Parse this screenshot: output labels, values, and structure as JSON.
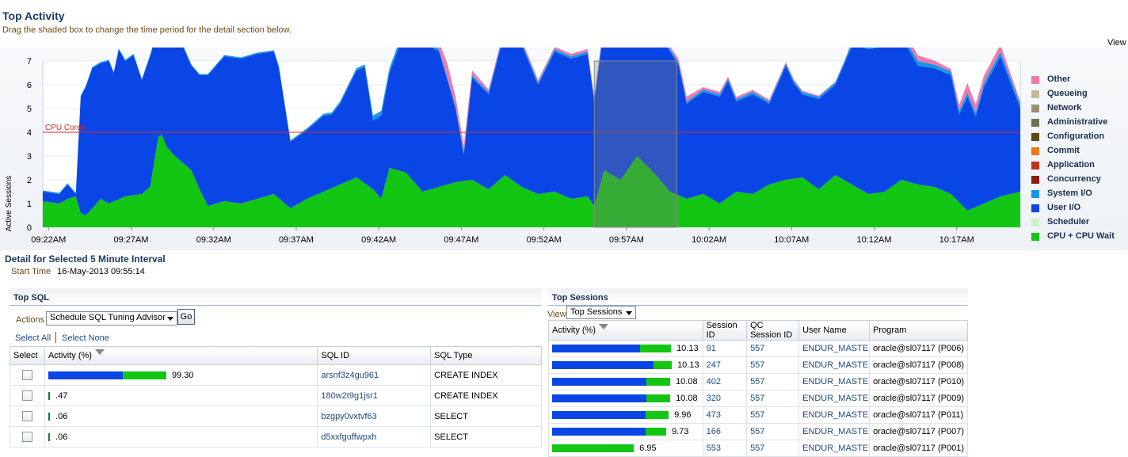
{
  "header": {
    "title": "Top Activity",
    "subtitle": "Drag the shaded box to change the time period for the detail section below.",
    "view_link": "View"
  },
  "colors": {
    "cpu": "#13c613",
    "user_io": "#0a46e6",
    "system_io": "#1896e8",
    "concurrency": "#8b1a10",
    "application": "#c9301b",
    "commit": "#e8781c",
    "configuration": "#5c4a11",
    "administrative": "#6f7352",
    "network": "#9c8e74",
    "queueing": "#c7b996",
    "other": "#f07aa8",
    "scheduler": "#c9f2c2",
    "cpu_cores_line": "#d12b2b"
  },
  "chart_data": {
    "type": "area",
    "ylabel": "Active Sessions",
    "ylim": [
      0,
      7
    ],
    "yticks": [
      "0",
      "1",
      "2",
      "3",
      "4",
      "5",
      "6",
      "7"
    ],
    "xticks": [
      "09:22AM",
      "09:27AM",
      "09:32AM",
      "09:37AM",
      "09:42AM",
      "09:47AM",
      "09:52AM",
      "09:57AM",
      "10:02AM",
      "10:07AM",
      "10:12AM",
      "10:17AM"
    ],
    "x_start_min": 0,
    "x_end_min": 59.2,
    "cpu_cores": {
      "label": "CPU Cores",
      "value": 4
    },
    "selection": {
      "start_min": 33.4,
      "end_min": 38.4
    },
    "series_order": [
      "CPU + CPU Wait",
      "User I/O",
      "System I/O",
      "Other"
    ],
    "series": [
      {
        "name": "CPU + CPU Wait",
        "x": [
          0,
          1,
          1.5,
          2.0,
          2.3,
          2.6,
          3,
          3.5,
          4,
          5,
          6,
          6.5,
          7,
          7.2,
          7.5,
          8,
          8.5,
          9,
          9.5,
          10,
          11,
          12,
          13,
          14,
          15,
          16,
          17,
          18,
          19,
          20,
          20.5,
          21,
          22,
          23,
          24,
          25,
          26,
          27,
          28,
          29,
          30,
          31,
          32,
          33,
          33.4,
          34,
          35,
          36,
          37,
          38,
          39,
          40,
          41,
          42,
          43,
          44,
          45,
          46,
          47,
          48,
          49,
          50,
          51,
          52,
          53,
          54,
          55,
          56,
          57,
          58,
          59.2
        ],
        "y": [
          1.1,
          1.0,
          1.2,
          1.3,
          0.6,
          0.5,
          0.8,
          1.2,
          1.0,
          1.3,
          1.4,
          1.7,
          3.8,
          3.9,
          3.4,
          3.0,
          2.7,
          2.4,
          1.6,
          0.9,
          1.1,
          1.0,
          1.2,
          1.4,
          0.8,
          1.2,
          1.5,
          1.8,
          2.1,
          1.6,
          1.2,
          2.5,
          2.3,
          1.5,
          1.7,
          1.9,
          2.0,
          1.6,
          2.2,
          1.7,
          1.4,
          1.5,
          1.2,
          1.3,
          0.9,
          2.4,
          2.0,
          3.0,
          2.3,
          1.5,
          1.2,
          1.4,
          1.0,
          1.5,
          1.4,
          1.8,
          2.0,
          2.1,
          1.6,
          2.2,
          1.8,
          1.4,
          1.5,
          2.0,
          1.8,
          1.7,
          1.4,
          0.7,
          1.0,
          1.3,
          1.5
        ]
      },
      {
        "name": "User I/O",
        "x": [
          0,
          1,
          1.5,
          2.0,
          2.3,
          2.6,
          3,
          3.5,
          4,
          4.3,
          4.6,
          5,
          5.5,
          6,
          6.5,
          7,
          7.5,
          8,
          8.5,
          9,
          9.5,
          10,
          11,
          12,
          13,
          14,
          14.3,
          15,
          16,
          17,
          17.5,
          18,
          19,
          19.5,
          20,
          20.5,
          21,
          22,
          23,
          23.5,
          24,
          25,
          25.5,
          26,
          27,
          28,
          29,
          30,
          31,
          32,
          33,
          33.4,
          34,
          35,
          36,
          37,
          38,
          38.5,
          39,
          40,
          41,
          41.5,
          42,
          43,
          44,
          45,
          45.5,
          46,
          47,
          48,
          49,
          49.5,
          50,
          51,
          52,
          53,
          54,
          55,
          55.5,
          56,
          56.5,
          57,
          58,
          59.2
        ],
        "y": [
          0.4,
          0.4,
          0.6,
          0.1,
          4.9,
          5.4,
          5.9,
          5.7,
          6.0,
          5.4,
          6.3,
          5.7,
          5.9,
          4.8,
          5.5,
          4.6,
          4.7,
          5.3,
          4.9,
          4.4,
          4.8,
          5.5,
          6.1,
          6.1,
          6.1,
          6.0,
          5.5,
          2.8,
          2.9,
          3.2,
          3.1,
          3.4,
          4.5,
          4.9,
          2.9,
          3.5,
          4.0,
          6.1,
          6.1,
          6.0,
          5.7,
          3.1,
          1.1,
          4.3,
          4.0,
          6.1,
          6.0,
          4.6,
          5.9,
          5.9,
          6.0,
          4.4,
          6.1,
          6.2,
          5.8,
          6.0,
          5.9,
          5.5,
          4.0,
          4.3,
          4.5,
          4.9,
          3.8,
          4.2,
          3.4,
          4.8,
          4.0,
          3.5,
          3.8,
          3.8,
          5.8,
          6.0,
          6.1,
          6.1,
          6.0,
          5.0,
          5.0,
          5.0,
          3.7,
          4.8,
          3.8,
          4.9,
          5.9,
          3.5
        ]
      },
      {
        "name": "System I/O",
        "x": [
          0,
          10,
          14,
          19.5,
          20,
          23.5,
          24,
          29,
          30,
          41,
          42,
          48.5,
          49,
          53,
          54,
          59.2
        ],
        "y": [
          0.05,
          0.05,
          0.05,
          0.1,
          0.2,
          0.2,
          0.1,
          0.1,
          0.1,
          0.1,
          0.1,
          0.1,
          0.2,
          0.2,
          0.15,
          0.2
        ]
      },
      {
        "name": "Other",
        "x": [
          0,
          10,
          23.5,
          24,
          24.5,
          25,
          26,
          27,
          29,
          38,
          39,
          40,
          41,
          51,
          52,
          55,
          56,
          57,
          58,
          59.2
        ],
        "y": [
          0,
          0,
          0,
          0.3,
          0.6,
          0.4,
          0.2,
          0.1,
          0.1,
          0.1,
          0.2,
          0.1,
          0.1,
          0,
          0.3,
          0.1,
          0.4,
          0.3,
          0.3,
          0.1
        ]
      }
    ],
    "legend": [
      "Other",
      "Queueing",
      "Network",
      "Administrative",
      "Configuration",
      "Commit",
      "Application",
      "Concurrency",
      "System I/O",
      "User I/O",
      "Scheduler",
      "CPU + CPU Wait"
    ]
  },
  "detail": {
    "title": "Detail for Selected 5 Minute Interval",
    "start_time_label": "Start Time",
    "start_time_value": "16-May-2013 09:55:14"
  },
  "top_sql": {
    "title": "Top SQL",
    "actions_label": "Actions",
    "actions_value": "Schedule SQL Tuning Advisor",
    "go_label": "Go",
    "select_all": "Select All",
    "select_none": "Select None",
    "columns": [
      "Select",
      "Activity (%)",
      "SQL ID",
      "SQL Type"
    ],
    "rows": [
      {
        "activity": "99.30",
        "activity_pct": 99.3,
        "user_io_share": 0.63,
        "sql_id": "arsnf3z4gu961",
        "sql_type": "CREATE INDEX"
      },
      {
        "activity": ".47",
        "activity_pct": 0.47,
        "user_io_share": 0.0,
        "sql_id": "180w2t9g1jsr1",
        "sql_type": "CREATE INDEX"
      },
      {
        "activity": ".06",
        "activity_pct": 0.06,
        "user_io_share": 0.0,
        "sql_id": "bzgpy0vxtvf63",
        "sql_type": "SELECT"
      },
      {
        "activity": ".06",
        "activity_pct": 0.06,
        "user_io_share": 0.0,
        "sql_id": "d5xxfguffwpxh",
        "sql_type": "SELECT"
      }
    ]
  },
  "top_sessions": {
    "title": "Top Sessions",
    "view_label": "View",
    "view_value": "Top Sessions",
    "columns": [
      "Activity (%)",
      "Session ID",
      "QC Session ID",
      "User Name",
      "Program"
    ],
    "rows": [
      {
        "activity": "10.13",
        "activity_pct": 10.13,
        "user_io_share": 0.74,
        "session_id": "91",
        "qc_session_id": "557",
        "user_name": "ENDUR_MASTER",
        "program": "oracle@sl07117 (P006)"
      },
      {
        "activity": "10.13",
        "activity_pct": 10.13,
        "user_io_share": 0.85,
        "session_id": "247",
        "qc_session_id": "557",
        "user_name": "ENDUR_MASTER",
        "program": "oracle@sl07117 (P008)"
      },
      {
        "activity": "10.08",
        "activity_pct": 10.08,
        "user_io_share": 0.8,
        "session_id": "402",
        "qc_session_id": "557",
        "user_name": "ENDUR_MASTER",
        "program": "oracle@sl07117 (P010)"
      },
      {
        "activity": "10.08",
        "activity_pct": 10.08,
        "user_io_share": 0.8,
        "session_id": "320",
        "qc_session_id": "557",
        "user_name": "ENDUR_MASTER",
        "program": "oracle@sl07117 (P009)"
      },
      {
        "activity": "9.96",
        "activity_pct": 9.96,
        "user_io_share": 0.8,
        "session_id": "473",
        "qc_session_id": "557",
        "user_name": "ENDUR_MASTER",
        "program": "oracle@sl07117 (P011)"
      },
      {
        "activity": "9.73",
        "activity_pct": 9.73,
        "user_io_share": 0.82,
        "session_id": "166",
        "qc_session_id": "557",
        "user_name": "ENDUR_MASTER",
        "program": "oracle@sl07117 (P007)"
      },
      {
        "activity": "6.95",
        "activity_pct": 6.95,
        "user_io_share": 0.0,
        "session_id": "553",
        "qc_session_id": "557",
        "user_name": "ENDUR_MASTER",
        "program": "oracle@sl07117 (P001)"
      }
    ]
  }
}
